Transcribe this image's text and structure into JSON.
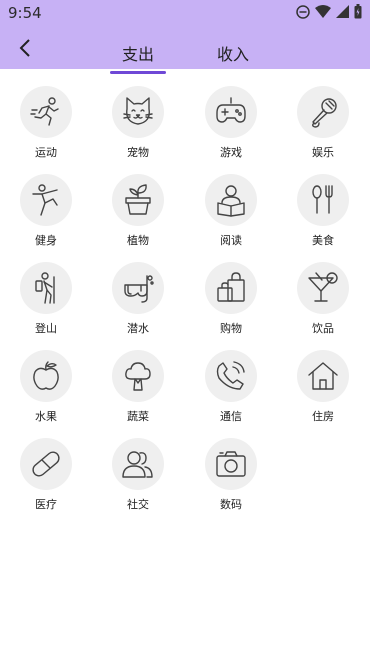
{
  "status": {
    "time": "9:54"
  },
  "header": {
    "tabs": [
      "支出",
      "收入"
    ],
    "active_tab": 0
  },
  "categories": [
    {
      "label": "运动",
      "icon": "running-icon"
    },
    {
      "label": "宠物",
      "icon": "cat-icon"
    },
    {
      "label": "游戏",
      "icon": "gamepad-icon"
    },
    {
      "label": "娱乐",
      "icon": "microphone-icon"
    },
    {
      "label": "健身",
      "icon": "yoga-icon"
    },
    {
      "label": "植物",
      "icon": "plant-pot-icon"
    },
    {
      "label": "阅读",
      "icon": "reading-icon"
    },
    {
      "label": "美食",
      "icon": "cutlery-icon"
    },
    {
      "label": "登山",
      "icon": "hiker-icon"
    },
    {
      "label": "潜水",
      "icon": "diving-mask-icon"
    },
    {
      "label": "购物",
      "icon": "shopping-bag-icon"
    },
    {
      "label": "饮品",
      "icon": "cocktail-icon"
    },
    {
      "label": "水果",
      "icon": "apple-icon"
    },
    {
      "label": "蔬菜",
      "icon": "broccoli-icon"
    },
    {
      "label": "通信",
      "icon": "phone-icon"
    },
    {
      "label": "住房",
      "icon": "house-icon"
    },
    {
      "label": "医疗",
      "icon": "pill-icon"
    },
    {
      "label": "社交",
      "icon": "people-icon"
    },
    {
      "label": "数码",
      "icon": "camera-icon"
    }
  ]
}
